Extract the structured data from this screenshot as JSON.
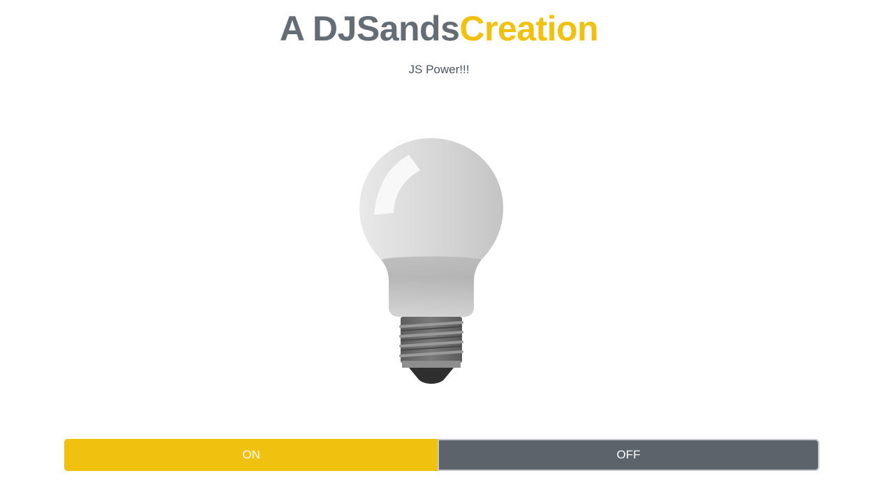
{
  "header": {
    "title_main": "A DJSands",
    "title_accent": "Creation",
    "subtitle": "JS Power!!!"
  },
  "bulb": {
    "icon": "light-bulb-icon",
    "state": "off"
  },
  "controls": {
    "on_label": "ON",
    "off_label": "OFF"
  },
  "colors": {
    "accent": "#f0c20f",
    "title_gray": "#646c74",
    "button_off": "#5c636a"
  }
}
